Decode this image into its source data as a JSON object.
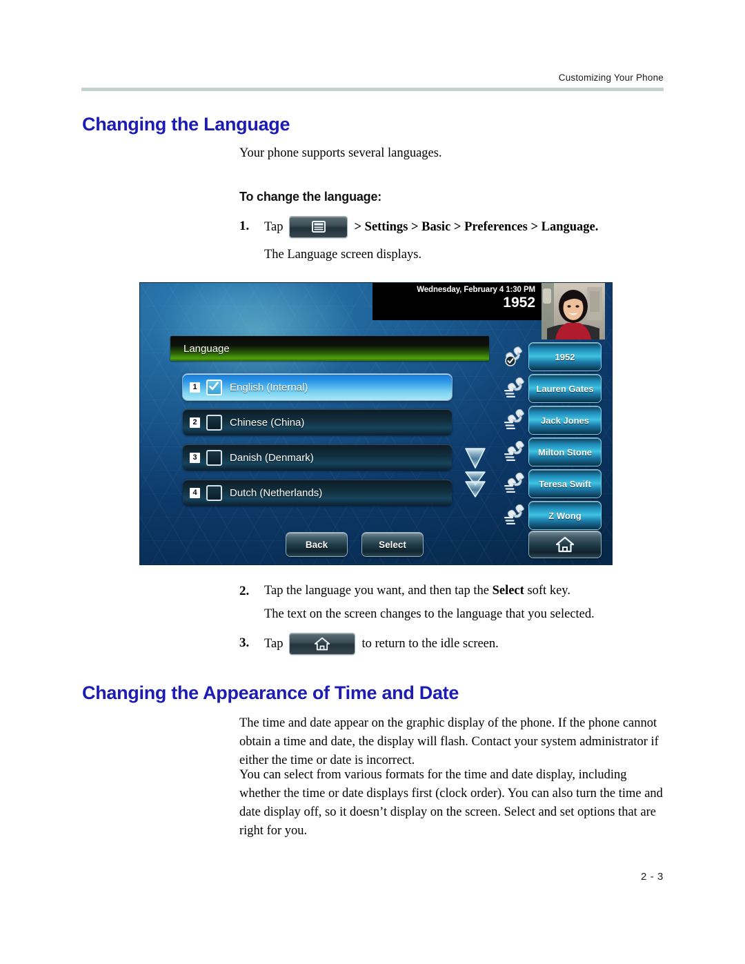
{
  "document": {
    "running_head": "Customizing Your Phone",
    "page_number": "2 - 3"
  },
  "sections": [
    {
      "title": "Changing the Language",
      "intro": "Your phone supports several languages.",
      "sub_head": "To change the language:",
      "steps": [
        {
          "number": "1.",
          "lead": "Tap",
          "icon": "menu-key-icon",
          "tail": "> Settings > Basic > Preferences > Language.",
          "result": "The Language screen displays."
        },
        {
          "number": "2.",
          "text_before_bold": "Tap the language you want, and then tap the ",
          "bold": "Select",
          "text_after_bold": " soft key.",
          "result": "The text on the screen changes to the language that you selected."
        },
        {
          "number": "3.",
          "lead": "Tap",
          "icon": "home-key-icon",
          "tail": "to return to the idle screen."
        }
      ]
    },
    {
      "title": "Changing the Appearance of Time and Date",
      "paragraphs": [
        "The time and date appear on the graphic display of the phone. If the phone cannot obtain a time and date, the display will flash. Contact your system administrator if either the time or date is incorrect.",
        "You can select from various formats for the time and date display, including whether the time or date displays first (clock order). You can also turn the time and date display off, so it doesn’t display on the screen. Select and set options that are right for you."
      ]
    }
  ],
  "phone_screenshot": {
    "status_bar": {
      "datetime": "Wednesday, February 4  1:30 PM",
      "extension": "1952"
    },
    "video_thumbnail": "near-site-video-icon",
    "title_bar": {
      "label": "Language"
    },
    "language_list": [
      {
        "index": "1",
        "label": "English (Internal)",
        "checked": true,
        "selected": true
      },
      {
        "index": "2",
        "label": "Chinese (China)",
        "checked": false,
        "selected": false
      },
      {
        "index": "3",
        "label": "Danish (Denmark)",
        "checked": false,
        "selected": false
      },
      {
        "index": "4",
        "label": "Dutch (Netherlands)",
        "checked": false,
        "selected": false
      }
    ],
    "scroll_indicators": [
      "scroll-down-icon",
      "scroll-page-down-icon"
    ],
    "line_keys": [
      {
        "label": "1952",
        "icon": "handset-registered-icon"
      },
      {
        "label": "Lauren Gates",
        "icon": "handset-blf-icon"
      },
      {
        "label": "Jack Jones",
        "icon": "handset-blf-icon"
      },
      {
        "label": "Milton Stone",
        "icon": "handset-blf-icon"
      },
      {
        "label": "Teresa Swift",
        "icon": "handset-blf-icon"
      },
      {
        "label": "Z Wong",
        "icon": "handset-blf-icon"
      }
    ],
    "soft_keys": [
      {
        "label": "Back"
      },
      {
        "label": "Select"
      }
    ],
    "home_key": "home-icon"
  },
  "colors": {
    "heading_blue": "#1c1cb4",
    "rule_sage": "#c2d2cd",
    "title_bar_green": "#4fa10a",
    "selected_row_blue": "#2f9ae8",
    "line_key_cyan": "#3fc3e2"
  }
}
